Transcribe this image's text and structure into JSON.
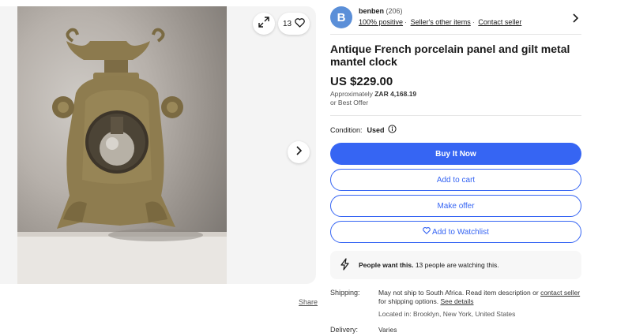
{
  "gallery": {
    "image_alt": "Antique French porcelain panel and gilt metal mantel clock",
    "watch_count": "13",
    "share_label": "Share",
    "icons": {
      "expand": "expand-icon",
      "heart": "heart-icon",
      "next": "chevron-right-icon"
    }
  },
  "seller": {
    "avatar_letter": "B",
    "name": "benben",
    "feedback_count": "(206)",
    "positive": "100% positive",
    "other_items": "Seller's other items",
    "contact": "Contact seller"
  },
  "listing": {
    "title": "Antique French porcelain panel and gilt metal mantel clock",
    "price": "US $229.00",
    "approx_label": "Approximately",
    "approx_value": "ZAR 4,168.19",
    "best_offer": "or Best Offer",
    "condition_label": "Condition:",
    "condition_value": "Used"
  },
  "actions": {
    "buy_now": "Buy It Now",
    "add_to_cart": "Add to cart",
    "make_offer": "Make offer",
    "add_to_watchlist": "Add to Watchlist"
  },
  "demand": {
    "bold": "People want this.",
    "text": "13 people are watching this."
  },
  "shipping": {
    "label": "Shipping:",
    "text_before": "May not ship to South Africa. Read item description or",
    "contact_link": "contact seller",
    "text_after": "for shipping options.",
    "details_link": "See details",
    "location": "Located in: Brooklyn, New York, United States"
  },
  "delivery": {
    "label": "Delivery:",
    "value": "Varies"
  },
  "colors": {
    "accent": "#3665f3",
    "avatar": "#5b8fd8"
  }
}
